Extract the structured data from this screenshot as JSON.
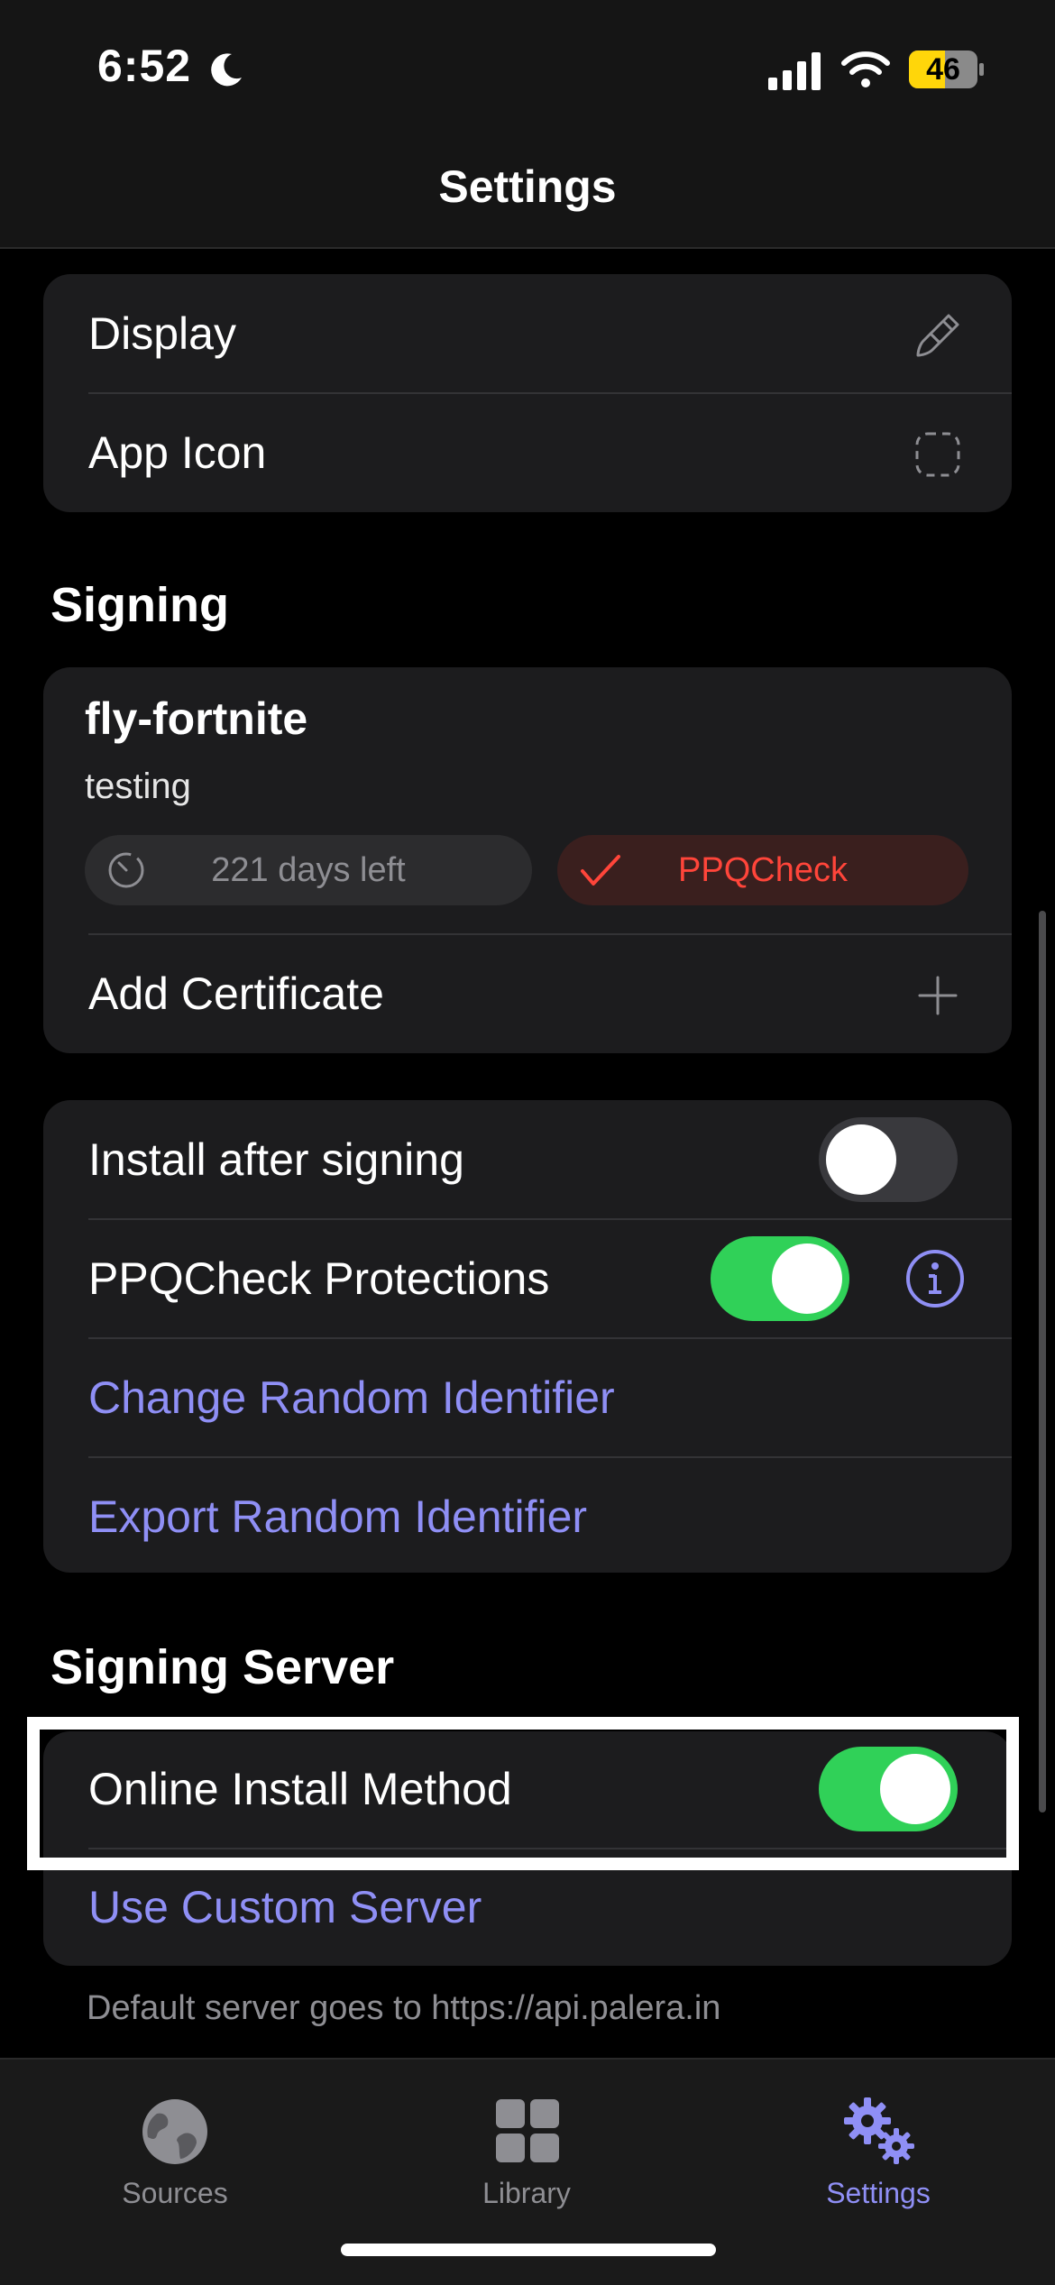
{
  "status_bar": {
    "time": "6:52",
    "battery": "46"
  },
  "nav": {
    "title": "Settings"
  },
  "appearance": {
    "display_label": "Display",
    "app_icon_label": "App Icon"
  },
  "signing": {
    "section_title": "Signing",
    "certificate": {
      "name": "fly-fortnite",
      "subtitle": "testing",
      "days_left": "221 days left",
      "status": "PPQCheck"
    },
    "add_certificate_label": "Add Certificate"
  },
  "options": {
    "install_after_signing": {
      "label": "Install after signing",
      "enabled": false
    },
    "ppqcheck_protections": {
      "label": "PPQCheck Protections",
      "enabled": true
    },
    "change_identifier_label": "Change Random Identifier",
    "export_identifier_label": "Export Random Identifier"
  },
  "signing_server": {
    "section_title": "Signing Server",
    "online_install": {
      "label": "Online Install Method",
      "enabled": true
    },
    "custom_server_label": "Use Custom Server",
    "footer_note": "Default server goes to https://api.palera.in"
  },
  "tabs": [
    {
      "label": "Sources",
      "icon": "globe-icon",
      "active": false
    },
    {
      "label": "Library",
      "icon": "grid-icon",
      "active": false
    },
    {
      "label": "Settings",
      "icon": "gears-icon",
      "active": true
    }
  ],
  "colors": {
    "accent": "#8f8ff5",
    "toggle_on": "#30d158",
    "danger": "#ff453a"
  }
}
